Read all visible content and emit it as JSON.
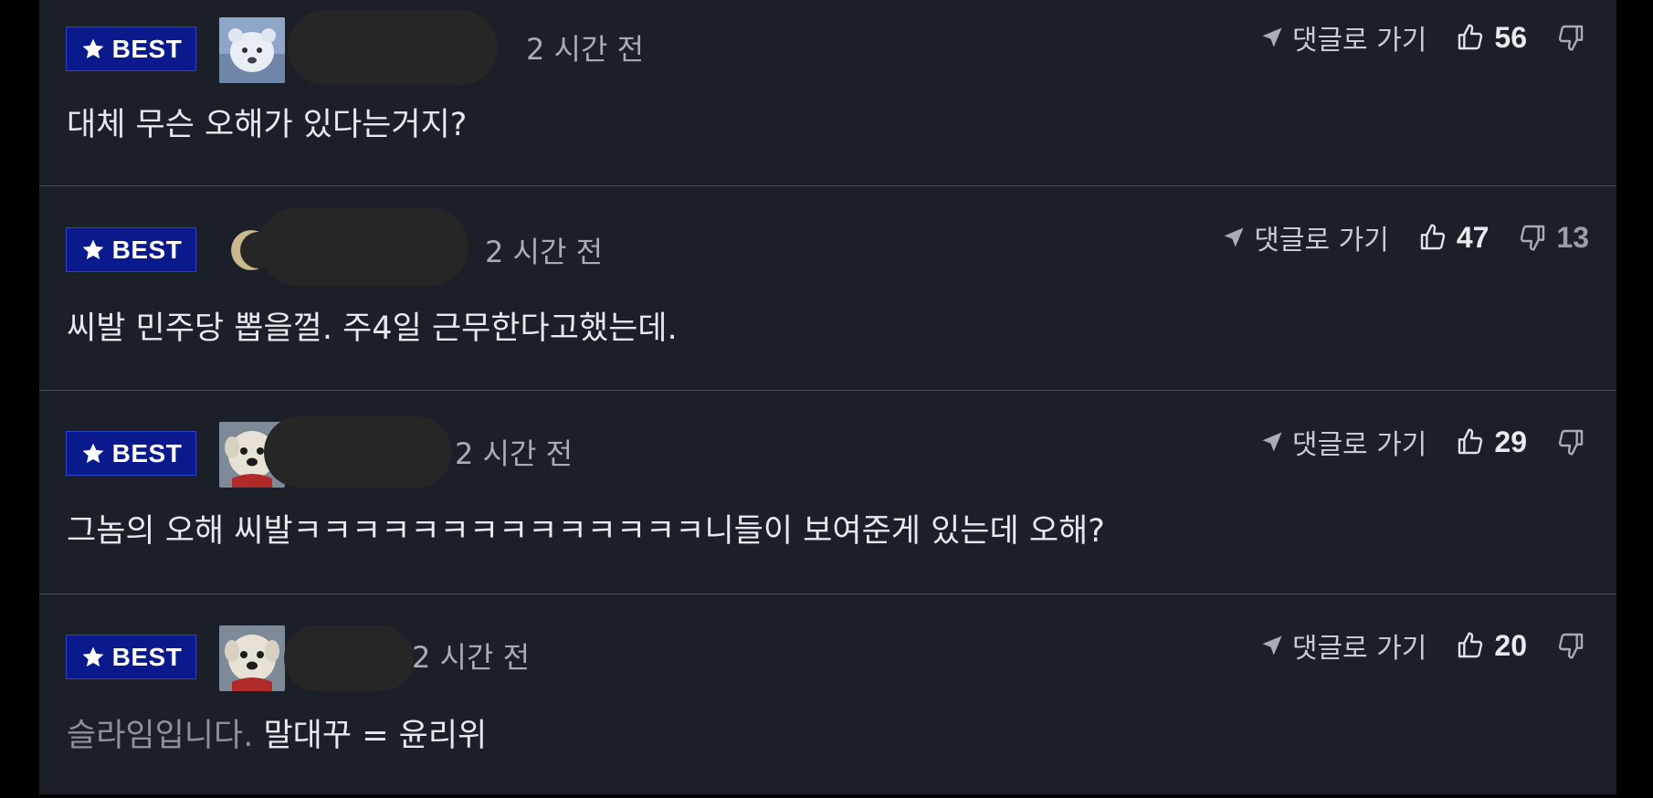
{
  "comments": [
    {
      "badge": "BEST",
      "time": "2 시간 전",
      "goto_label": "댓글로 가기",
      "likes": "56",
      "dislikes": "",
      "text": "대체 무슨 오해가 있다는거지?",
      "text_dim": ""
    },
    {
      "badge": "BEST",
      "time": "2 시간 전",
      "goto_label": "댓글로 가기",
      "likes": "47",
      "dislikes": "13",
      "text": "씨발 민주당 뽑을껄. 주4일 근무한다고했는데.",
      "text_dim": ""
    },
    {
      "badge": "BEST",
      "time": "2 시간 전",
      "goto_label": "댓글로 가기",
      "likes": "29",
      "dislikes": "",
      "text": "그놈의 오해 씨발ㅋㅋㅋㅋㅋㅋㅋㅋㅋㅋㅋㅋㅋㅋ니들이 보여준게 있는데 오해?",
      "text_dim": ""
    },
    {
      "badge": "BEST",
      "time": "2 시간 전",
      "goto_label": "댓글로 가기",
      "likes": "20",
      "dislikes": "",
      "text_dim": "슬라임입니다.",
      "text": "말대꾸 = 윤리위"
    }
  ],
  "colors": {
    "background": "#1b1f27",
    "best_badge": "#0a1a8c",
    "text": "#e6e8eb",
    "muted": "#a8acb3"
  }
}
